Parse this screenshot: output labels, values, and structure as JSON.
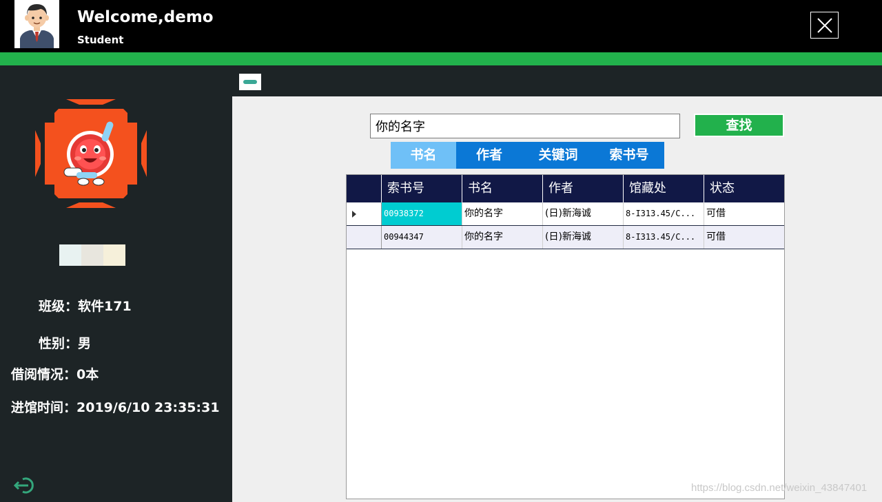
{
  "header": {
    "welcome": "Welcome,demo",
    "role": "Student"
  },
  "sidebar": {
    "class_label": "班级：",
    "class_value": "软件171",
    "gender_label": "性别：",
    "gender_value": "男",
    "borrow_label": "借阅情况：",
    "borrow_value": "0本",
    "entry_label": "进馆时间：",
    "entry_value": "2019/6/10 23:35:31",
    "swatch_colors": [
      "#e8f2f1",
      "#e8e6de",
      "#f6f0da"
    ]
  },
  "search": {
    "value": "你的名字",
    "button_label": "查找"
  },
  "tabs": [
    {
      "label": "书名",
      "active": true
    },
    {
      "label": "作者",
      "active": false
    },
    {
      "label": "关键词",
      "active": false
    },
    {
      "label": "索书号",
      "active": false
    }
  ],
  "grid": {
    "columns": [
      "索书号",
      "书名",
      "作者",
      "馆藏处",
      "状态"
    ],
    "rows": [
      [
        "00938372",
        "你的名字",
        "(日)新海诚",
        "8-I313.45/C...",
        "可借"
      ],
      [
        "00944347",
        "你的名字",
        "(日)新海诚",
        "8-I313.45/C...",
        "可借"
      ]
    ]
  },
  "watermark": "https://blog.csdn.net/weixin_43847401",
  "colors": {
    "accent_green": "#22b14c",
    "tab_blue": "#0b78d6",
    "tab_active": "#6fc0f7",
    "grid_header": "#111846",
    "selected_cell": "#00ccd1"
  },
  "icons": {
    "close": "close-icon",
    "minimize": "minimize-icon",
    "logout": "logout-icon"
  }
}
